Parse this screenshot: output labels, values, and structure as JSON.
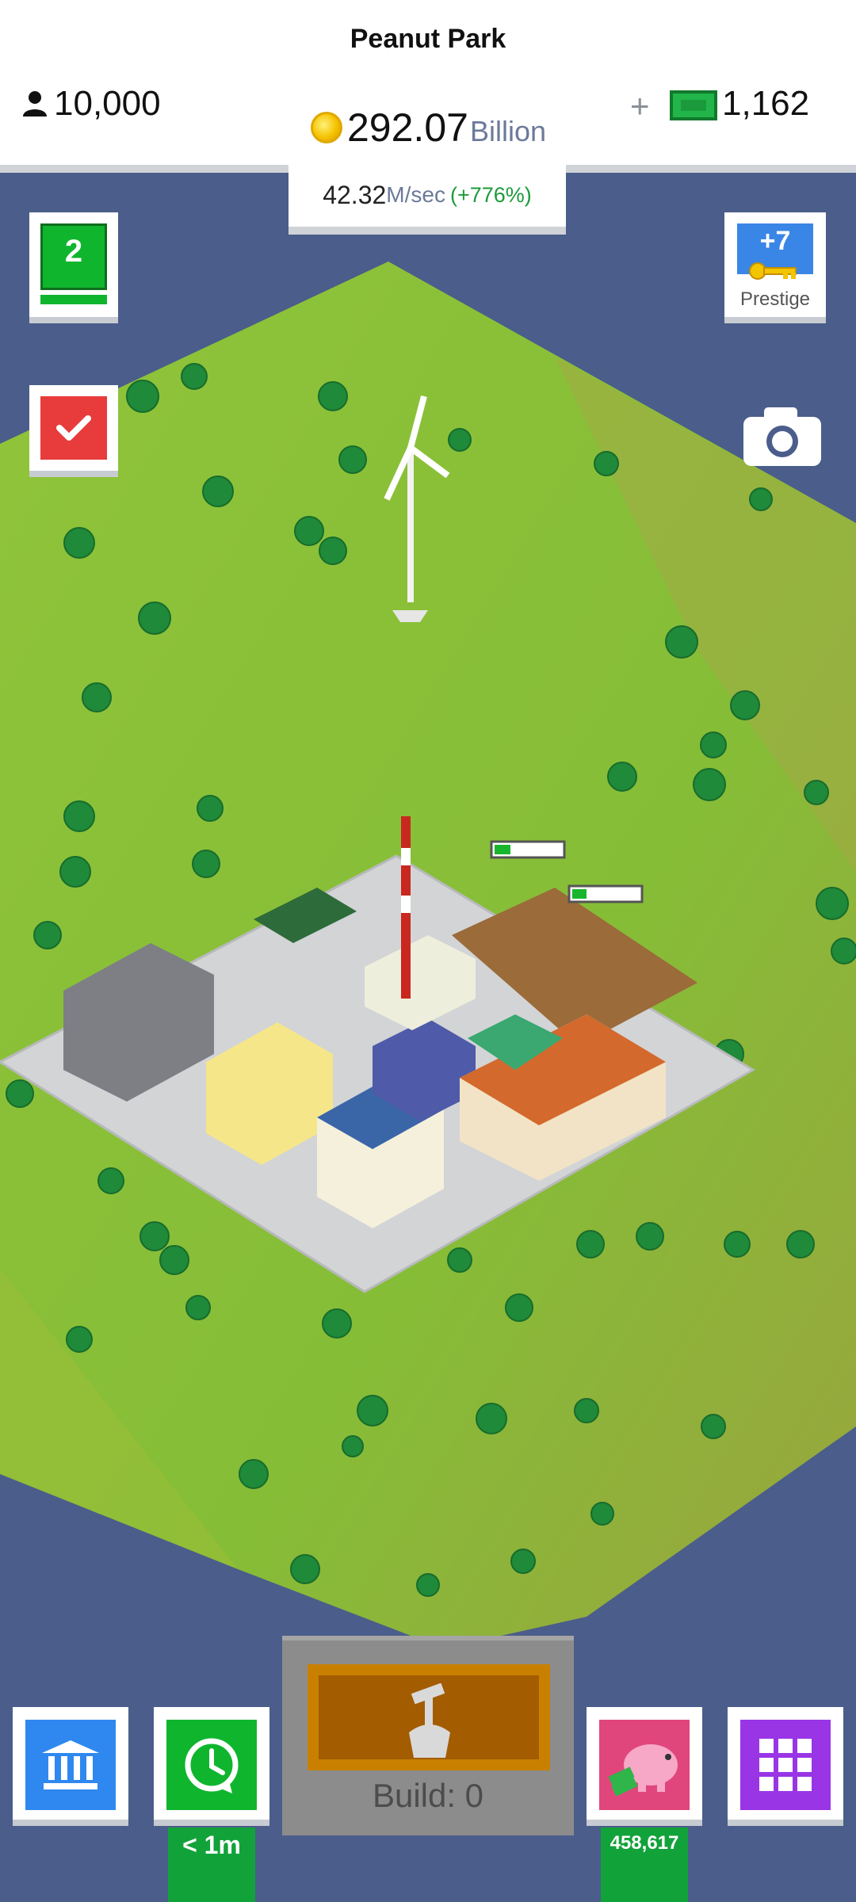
{
  "header": {
    "city_name": "Peanut Park",
    "population": "10,000",
    "coins_value": "292.07",
    "coins_unit": "Billion",
    "rate_value": "42.32",
    "rate_unit": "M/sec",
    "rate_boost": "(+776%)",
    "add_cash_symbol": "+",
    "cash_value": "1,162"
  },
  "side_buttons": {
    "level": "2",
    "prestige_count": "+7",
    "prestige_label": "Prestige"
  },
  "bottom": {
    "timer_label": "< 1m",
    "saving_label": "458,617",
    "build_label": "Build: 0"
  },
  "icons": [
    "person-icon",
    "coin-icon",
    "cash-icon",
    "check-icon",
    "key-icon",
    "camera-icon",
    "bank-icon",
    "boost-clock-icon",
    "hammer-icon",
    "piggy-bank-icon",
    "grid-menu-icon"
  ],
  "colors": {
    "water": "#4b5d8a",
    "grass": "#8fc43a",
    "level_green": "#10b52e",
    "tasks_red": "#e83b3b",
    "prestige_blue": "#3a86e6",
    "bank_blue": "#2f88ef",
    "boost_green": "#10b52e",
    "piggy_pink": "#e0467c",
    "menu_purple": "#9a35e6",
    "build_orange": "#c98000"
  }
}
